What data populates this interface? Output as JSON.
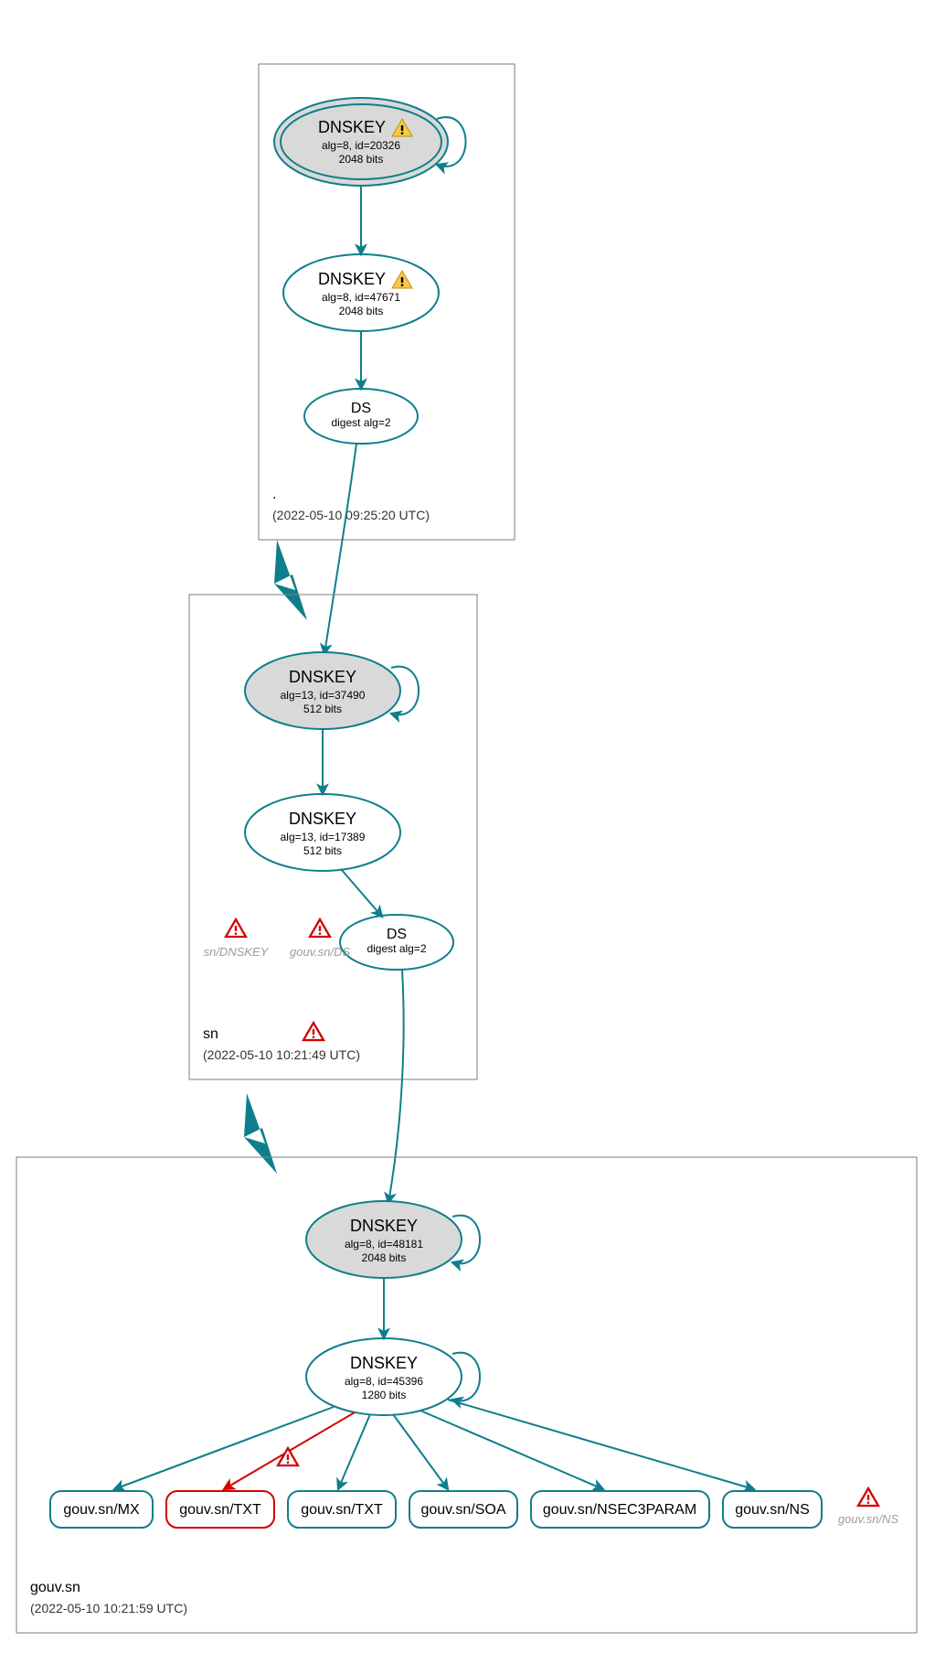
{
  "zones": {
    "root": {
      "label": ".",
      "timestamp": "(2022-05-10 09:25:20 UTC)",
      "dnskey1": {
        "title": "DNSKEY",
        "alg": "alg=8, id=20326",
        "bits": "2048 bits",
        "warning": true
      },
      "dnskey2": {
        "title": "DNSKEY",
        "alg": "alg=8, id=47671",
        "bits": "2048 bits",
        "warning": true
      },
      "ds": {
        "title": "DS",
        "sub": "digest alg=2"
      }
    },
    "sn": {
      "label": "sn",
      "timestamp": "(2022-05-10 10:21:49 UTC)",
      "dnskey1": {
        "title": "DNSKEY",
        "alg": "alg=13, id=37490",
        "bits": "512 bits"
      },
      "dnskey2": {
        "title": "DNSKEY",
        "alg": "alg=13, id=17389",
        "bits": "512 bits"
      },
      "ds": {
        "title": "DS",
        "sub": "digest alg=2"
      },
      "ghost1": "sn/DNSKEY",
      "ghost2": "gouv.sn/DS"
    },
    "gouv": {
      "label": "gouv.sn",
      "timestamp": "(2022-05-10 10:21:59 UTC)",
      "dnskey1": {
        "title": "DNSKEY",
        "alg": "alg=8, id=48181",
        "bits": "2048 bits"
      },
      "dnskey2": {
        "title": "DNSKEY",
        "alg": "alg=8, id=45396",
        "bits": "1280 bits"
      },
      "rrs": {
        "mx": "gouv.sn/MX",
        "txt1": "gouv.sn/TXT",
        "txt2": "gouv.sn/TXT",
        "soa": "gouv.sn/SOA",
        "nsec": "gouv.sn/NSEC3PARAM",
        "ns": "gouv.sn/NS"
      },
      "ghost_ns": "gouv.sn/NS"
    }
  }
}
